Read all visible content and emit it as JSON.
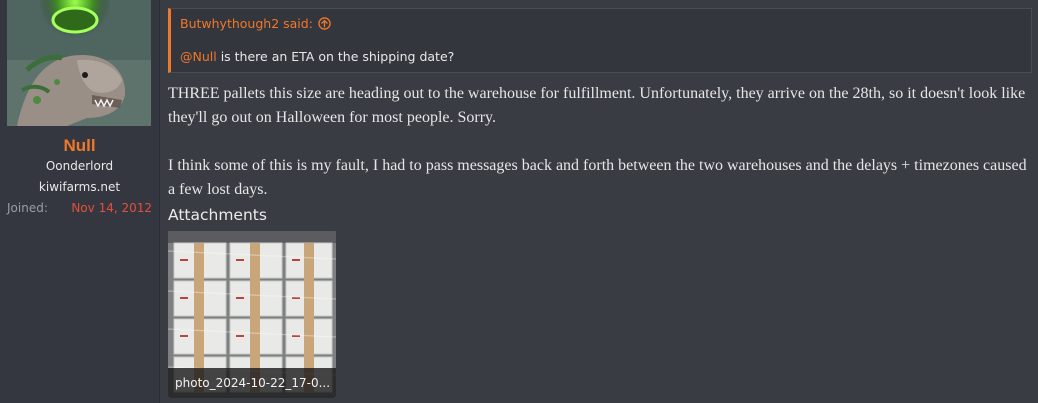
{
  "user": {
    "name": "Null",
    "title": "Oonderlord",
    "banner": "kiwifarms.net",
    "joined_label": "Joined:",
    "joined_date": "Nov 14, 2012"
  },
  "quote": {
    "author_line": "Butwhythough2 said:",
    "jump_icon": "arrow-up-circle-icon",
    "mention": "@Null",
    "text": " is there an ETA on the shipping date?"
  },
  "message": {
    "paragraphs": [
      "THREE pallets this size are heading out to the warehouse for fulfillment. Unfortunately, they arrive on the 28th, so it doesn't look like they'll go out on Halloween for most people. Sorry.",
      "I think some of this is my fault, I had to pass messages back and forth between the two warehouses and the delays + timezones caused a few lost days."
    ]
  },
  "attachments": {
    "title": "Attachments",
    "items": [
      {
        "filename": "photo_2024-10-22_17-0..."
      }
    ]
  },
  "colors": {
    "accent": "#f0782a",
    "background": "#3a3c44",
    "joined_date": "#e0513a"
  }
}
